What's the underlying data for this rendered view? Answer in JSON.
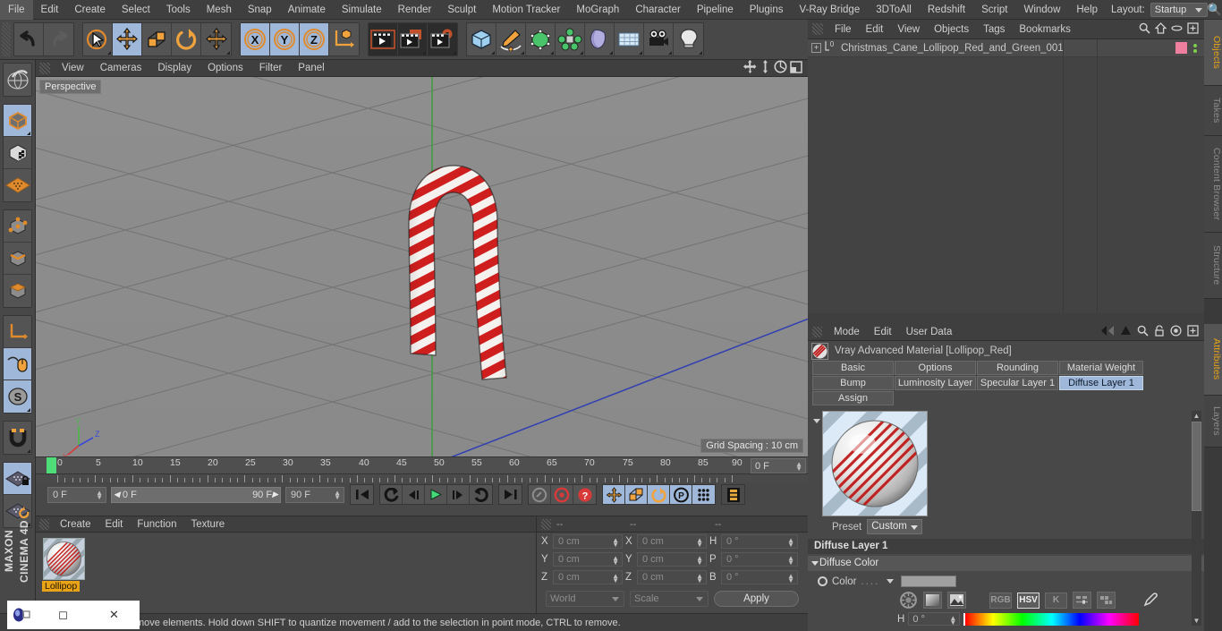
{
  "menubar": {
    "items": [
      "File",
      "Edit",
      "Create",
      "Select",
      "Tools",
      "Mesh",
      "Snap",
      "Animate",
      "Simulate",
      "Render",
      "Sculpt",
      "Motion Tracker",
      "MoGraph",
      "Character",
      "Pipeline",
      "Plugins",
      "V-Ray Bridge",
      "3DToAll",
      "Redshift",
      "Script",
      "Window",
      "Help"
    ],
    "layout_label": "Layout:",
    "layout_value": "Startup"
  },
  "toolbar": {
    "groups": [
      {
        "buttons": [
          {
            "name": "undo-icon",
            "sel": false,
            "dis": false
          },
          {
            "name": "redo-icon",
            "sel": false,
            "dis": true
          }
        ]
      },
      {
        "buttons": [
          {
            "name": "live-selection-icon",
            "sel": false,
            "dis": false
          },
          {
            "name": "move-tool-icon",
            "sel": true,
            "dis": false
          },
          {
            "name": "scale-tool-icon",
            "sel": false,
            "dis": false
          },
          {
            "name": "rotate-tool-icon",
            "sel": false,
            "dis": false
          },
          {
            "name": "move-alt-icon",
            "sel": false,
            "dis": false
          }
        ]
      },
      {
        "buttons": [
          {
            "name": "axis-x-icon",
            "sel": true,
            "dis": false
          },
          {
            "name": "axis-y-icon",
            "sel": true,
            "dis": false
          },
          {
            "name": "axis-z-icon",
            "sel": true,
            "dis": false
          },
          {
            "name": "world-coordinates-icon",
            "sel": false,
            "dis": false
          }
        ]
      },
      {
        "buttons": [
          {
            "name": "render-view-icon",
            "sel": false,
            "dis": false
          },
          {
            "name": "render-to-picture-viewer-icon",
            "sel": false,
            "dis": false
          },
          {
            "name": "render-settings-icon",
            "sel": false,
            "dis": false
          }
        ]
      },
      {
        "buttons": [
          {
            "name": "cube-primitive-icon",
            "sel": false,
            "dis": false
          },
          {
            "name": "spline-pen-icon",
            "sel": false,
            "dis": false
          },
          {
            "name": "generator-icon",
            "sel": false,
            "dis": false
          },
          {
            "name": "array-icon",
            "sel": false,
            "dis": false
          },
          {
            "name": "bend-deformer-icon",
            "sel": false,
            "dis": false
          },
          {
            "name": "floor-scene-icon",
            "sel": false,
            "dis": false
          },
          {
            "name": "camera-icon",
            "sel": false,
            "dis": false
          },
          {
            "name": "light-icon",
            "sel": false,
            "dis": false
          }
        ]
      }
    ]
  },
  "left_toolbar": {
    "groups": [
      {
        "buttons": [
          {
            "name": "make-editable-icon",
            "sel": false
          }
        ]
      },
      {
        "buttons": [
          {
            "name": "model-mode-icon",
            "sel": true
          },
          {
            "name": "texture-mode-icon",
            "sel": false
          },
          {
            "name": "workplane-mode-icon",
            "sel": false
          }
        ]
      },
      {
        "buttons": [
          {
            "name": "points-mode-icon",
            "sel": false
          },
          {
            "name": "edges-mode-icon",
            "sel": false
          },
          {
            "name": "polygons-mode-icon",
            "sel": false
          }
        ]
      },
      {
        "buttons": [
          {
            "name": "object-axis-mode-icon",
            "sel": false
          },
          {
            "name": "viewport-solo-icon",
            "sel": true
          },
          {
            "name": "enable-axis-icon",
            "sel": true
          }
        ]
      },
      {
        "buttons": [
          {
            "name": "snap-magnet-icon",
            "sel": false
          }
        ]
      },
      {
        "buttons": [
          {
            "name": "lock-workplane-icon",
            "sel": true
          },
          {
            "name": "planar-workplane-icon",
            "sel": false
          }
        ]
      }
    ],
    "brand_line1": "MAXON",
    "brand_line2": "CINEMA 4D"
  },
  "viewport": {
    "menu": [
      "View",
      "Cameras",
      "Display",
      "Options",
      "Filter",
      "Panel"
    ],
    "label": "Perspective",
    "grid_spacing": "Grid Spacing : 10 cm",
    "icons": [
      "pan-view-icon",
      "dolly-view-icon",
      "orbit-view-icon",
      "maximize-view-icon"
    ],
    "axis_colors": {
      "x": "#d63a3a",
      "y": "#4ab84a",
      "z": "#3a4ad6"
    },
    "background": "#8d8d8d",
    "object_colors": {
      "red": "#cc1111",
      "white": "#f2f0ee"
    }
  },
  "timeline": {
    "ticks": [
      "0",
      "5",
      "10",
      "15",
      "20",
      "25",
      "30",
      "35",
      "40",
      "45",
      "50",
      "55",
      "60",
      "65",
      "70",
      "75",
      "80",
      "85",
      "90"
    ],
    "current_frame_box": "0 F",
    "current_frame_field": "0 F",
    "range_start": "0 F",
    "range_end": "90 F",
    "max_frame_field": "90 F",
    "transport_icons": [
      "go-to-start-icon",
      "previous-key-icon",
      "step-back-icon",
      "play-icon",
      "step-forward-icon",
      "next-key-icon",
      "go-to-end-icon"
    ],
    "record_icons": [
      "autokey-icon",
      "record-active-objects-icon",
      "record-help-icon"
    ],
    "key_mode_icons": [
      "position-key-icon",
      "scale-key-icon",
      "rotation-key-icon",
      "parameter-key-icon",
      "point-level-animation-icon",
      "timeline-icon"
    ]
  },
  "material_manager": {
    "menu": [
      "Create",
      "Edit",
      "Function",
      "Texture"
    ],
    "material_name": "Lollipop"
  },
  "coordinates": {
    "headers": [
      "--",
      "--",
      "--"
    ],
    "rows": [
      {
        "label": "X",
        "pos": "0 cm",
        "label2": "X",
        "size": "0 cm",
        "label3": "H",
        "rot": "0 °"
      },
      {
        "label": "Y",
        "pos": "0 cm",
        "label2": "Y",
        "size": "0 cm",
        "label3": "P",
        "rot": "0 °"
      },
      {
        "label": "Z",
        "pos": "0 cm",
        "label2": "Z",
        "size": "0 cm",
        "label3": "B",
        "rot": "0 °"
      }
    ],
    "system": "World",
    "mode": "Scale",
    "apply": "Apply"
  },
  "statusbar": {
    "text": "move elements. Hold down SHIFT to quantize movement / add to the selection in point mode, CTRL to remove."
  },
  "taskbar_window": {
    "icons": [
      "app-icon",
      "restore-icon",
      "minimize-icon",
      "close-icon"
    ]
  },
  "object_manager": {
    "menu": [
      "File",
      "Edit",
      "View",
      "Objects",
      "Tags",
      "Bookmarks"
    ],
    "icons": [
      "search-icon",
      "home-icon",
      "ellipse-icon",
      "new-tab-icon"
    ],
    "rows": [
      {
        "name": "Christmas_Cane_Lollipop_Red_and_Green_001",
        "layer_badge": "0",
        "tag_color": "#ef7f9f"
      }
    ]
  },
  "attributes": {
    "menu": [
      "Mode",
      "Edit",
      "User Data"
    ],
    "icons": [
      "back-arrow-icon",
      "forward-arrow-icon",
      "up-arrow-icon",
      "search-icon",
      "lock-icon",
      "target-icon",
      "new-tab-icon"
    ],
    "title": "Vray Advanced Material [Lollipop_Red]",
    "tabs_row1": [
      "Basic",
      "Options",
      "Rounding",
      "Material Weight"
    ],
    "tabs_row2": [
      "Bump",
      "Luminosity Layer",
      "Specular Layer 1",
      "Diffuse Layer 1"
    ],
    "tabs_row3": [
      "Assign"
    ],
    "selected_tab": "Diffuse Layer 1",
    "preset_label": "Preset",
    "preset_value": "Custom",
    "section_title": "Diffuse Layer 1",
    "subsection_title": "Diffuse Color",
    "color_label": "Color",
    "color_dots": "....",
    "color_swatch": "#a0a0a0",
    "color_mode_buttons": [
      "RGB",
      "HSV",
      "K"
    ],
    "color_mode_selected": "HSV",
    "hue_label": "H",
    "hue_value": "0 °"
  },
  "vertical_tabs": {
    "right": [
      {
        "label": "Objects",
        "active": true
      },
      {
        "label": "Takes",
        "active": false
      },
      {
        "label": "Content Browser",
        "active": false
      },
      {
        "label": "Structure",
        "active": false
      },
      {
        "label": "Attributes",
        "active": true
      },
      {
        "label": "Layers",
        "active": false
      }
    ]
  }
}
